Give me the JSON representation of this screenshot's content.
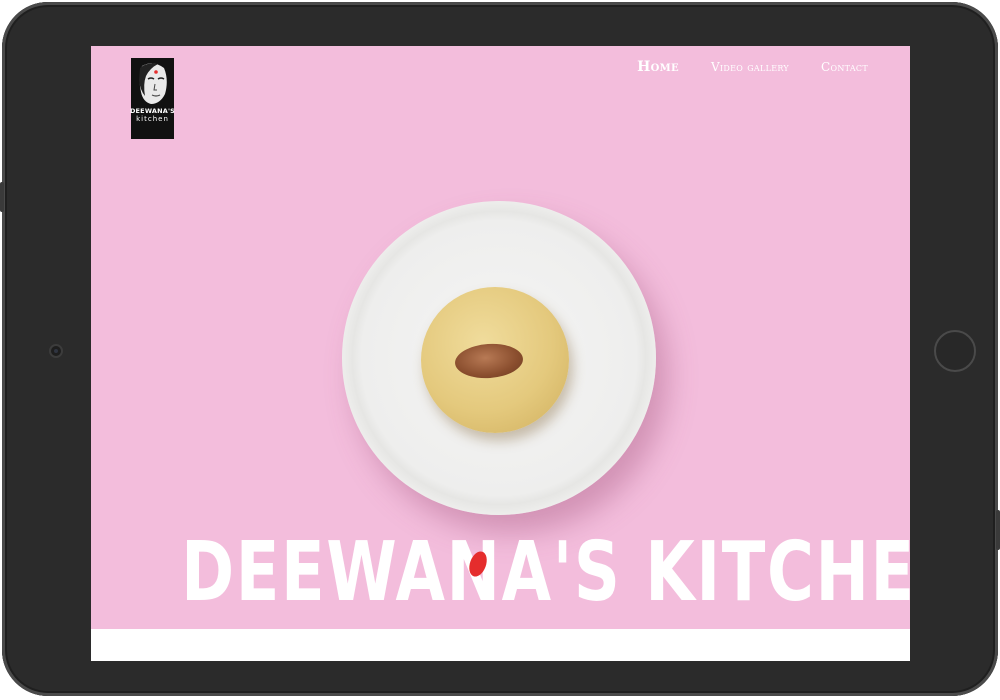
{
  "logo": {
    "line1": "DEEWANA'S",
    "line2": "kitchen"
  },
  "nav": {
    "items": [
      {
        "label": "Home",
        "active": true
      },
      {
        "label": "Video gallery",
        "active": false
      },
      {
        "label": "Contact",
        "active": false
      }
    ]
  },
  "hero": {
    "title": "DEEWANA'S KITCHEN",
    "accent_color": "#e52d2d",
    "background_color": "#f3bddc"
  }
}
